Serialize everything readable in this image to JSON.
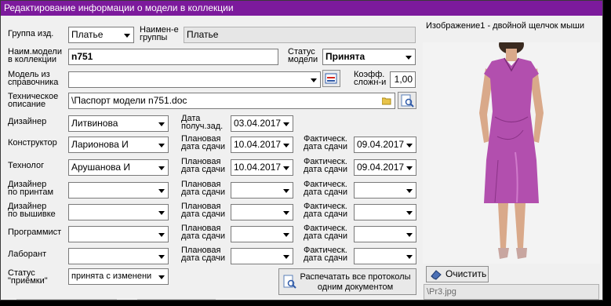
{
  "window": {
    "title": "Редактирование информации о модели в коллекции"
  },
  "row1": {
    "group_label": "Группа изд.",
    "group_value": "Платье",
    "group_name_label_1": "Наимен-е",
    "group_name_label_2": "группы",
    "group_name_value": "Платье"
  },
  "row2": {
    "model_name_label_1": "Наим.модели",
    "model_name_label_2": "в коллекции",
    "model_name_value": "n751",
    "status_label_1": "Статус",
    "status_label_2": "модели",
    "status_value": "Принята"
  },
  "row3": {
    "ref_model_label_1": "Модель из",
    "ref_model_label_2": "справочника",
    "ref_model_value": "",
    "coef_label_1": "Коэфф.",
    "coef_label_2": "сложн-и",
    "coef_value": "1,00"
  },
  "row4": {
    "tech_desc_label_1": "Техническое",
    "tech_desc_label_2": "описание",
    "tech_desc_value": "\\Паспорт модели n751.doc"
  },
  "designer": {
    "label": "Дизайнер",
    "value": "Литвинова",
    "date_label_1": "Дата",
    "date_label_2": "получ.зад.",
    "date_value": "03.04.2017"
  },
  "roles": [
    {
      "label_1": "Конструктор",
      "label_2": "",
      "value": "Ларионова И",
      "plan_label_1": "Плановая",
      "plan_label_2": "дата сдачи",
      "plan_value": "10.04.2017",
      "fact_label_1": "Фактическ.",
      "fact_label_2": "дата сдачи",
      "fact_value": "09.04.2017"
    },
    {
      "label_1": "Технолог",
      "label_2": "",
      "value": "Арушанова И",
      "plan_label_1": "Плановая",
      "plan_label_2": "дата сдачи",
      "plan_value": "10.04.2017",
      "fact_label_1": "Фактическ.",
      "fact_label_2": "дата сдачи",
      "fact_value": "09.04.2017"
    },
    {
      "label_1": "Дизайнер",
      "label_2": "по принтам",
      "value": "",
      "plan_label_1": "Плановая",
      "plan_label_2": "дата сдачи",
      "plan_value": "",
      "fact_label_1": "Фактическ.",
      "fact_label_2": "дата сдачи",
      "fact_value": ""
    },
    {
      "label_1": "Дизайнер",
      "label_2": "по вышивке",
      "value": "",
      "plan_label_1": "Плановая",
      "plan_label_2": "дата сдачи",
      "plan_value": "",
      "fact_label_1": "Фактическ.",
      "fact_label_2": "дата сдачи",
      "fact_value": ""
    },
    {
      "label_1": "Программист",
      "label_2": "",
      "value": "",
      "plan_label_1": "Плановая",
      "plan_label_2": "дата сдачи",
      "plan_value": "",
      "fact_label_1": "Фактическ.",
      "fact_label_2": "дата сдачи",
      "fact_value": ""
    },
    {
      "label_1": "Лаборант",
      "label_2": "",
      "value": "",
      "plan_label_1": "Плановая",
      "plan_label_2": "дата сдачи",
      "plan_value": "",
      "fact_label_1": "Фактическ.",
      "fact_label_2": "дата сдачи",
      "fact_value": ""
    }
  ],
  "acceptance": {
    "label_1": "Статус",
    "label_2": "\"приёмки\"",
    "value": "принята с изменени"
  },
  "print_button": {
    "label_1": "Распечатать все протоколы",
    "label_2": "одним документом"
  },
  "image": {
    "caption": "Изображение1 - двойной щелчок мыши",
    "clear_label": "Очистить",
    "path": "\\Pr3.jpg"
  },
  "colors": {
    "titlebar": "#7c1a9c",
    "dress": "#b24fae",
    "background": "#f0f0f0"
  },
  "icons": [
    "dropdown-arrow-icon",
    "select-model-icon",
    "folder-icon",
    "preview-icon",
    "print-icon",
    "eraser-icon"
  ]
}
